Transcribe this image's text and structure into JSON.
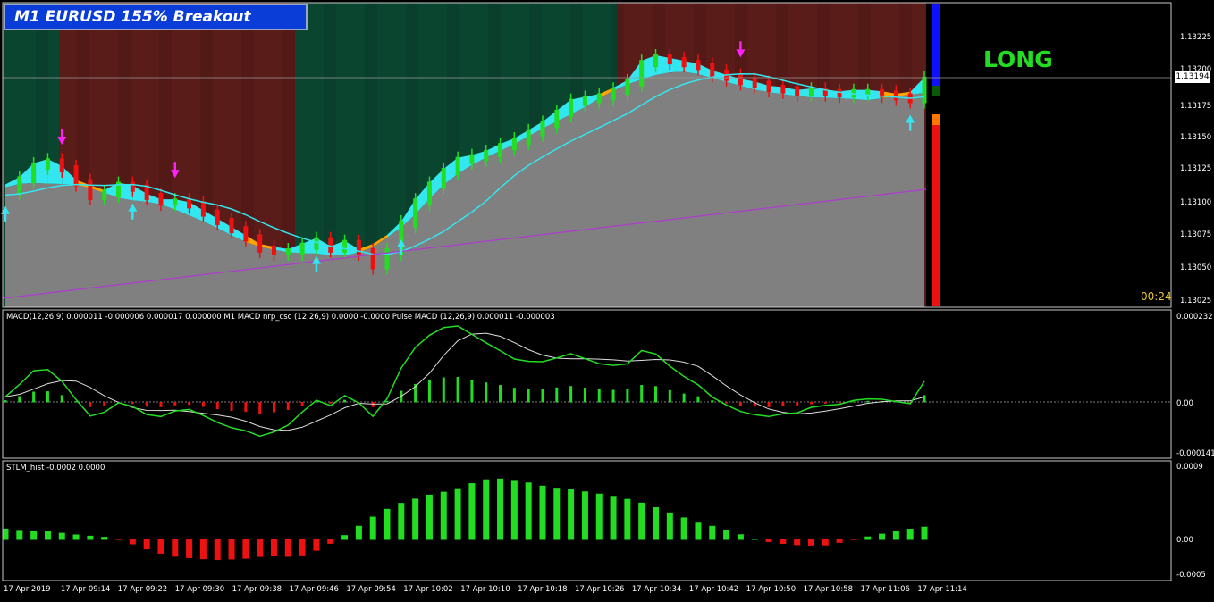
{
  "title": "M1 EURUSD  155% Breakout",
  "signal_text": "LONG",
  "timer": "00:24",
  "colors": {
    "bull": "#22dd22",
    "bear": "#ee1111",
    "cyan": "#33e6f0",
    "orange": "#ffa500",
    "magenta": "#ff22ff",
    "purple": "#b03ad0",
    "zone_green": "#0a4530",
    "zone_red": "#5a1c18",
    "fill_gray": "#808080",
    "signal_bar_blue": "#1010ff"
  },
  "main_chart": {
    "symbol": "EURUSD",
    "timeframe": "M1",
    "current_price": "1.13194",
    "price_ticks": [
      "1.13225",
      "1.13200",
      "1.13175",
      "1.13150",
      "1.13125",
      "1.13100",
      "1.13075",
      "1.13050",
      "1.13025"
    ],
    "ylim": [
      1.1302,
      1.1324
    ]
  },
  "macd_panel": {
    "label": "MACD(12,26,9) 0.000011 -0.000006 0.000017 0.000000  M1 MACD nrp_csc (12,26,9) 0.0000 -0.0000  Pulse MACD (12,26,9) 0.000011 -0.000003",
    "ticks": [
      "0.000232",
      "0.00",
      "-0.000141"
    ]
  },
  "stlm_panel": {
    "label": "STLM_hist -0.0002 0.0000",
    "ticks": [
      "0.0009",
      "0.00",
      "-0.0005"
    ]
  },
  "time_labels": [
    "17 Apr 2019",
    "17 Apr 09:14",
    "17 Apr 09:22",
    "17 Apr 09:30",
    "17 Apr 09:38",
    "17 Apr 09:46",
    "17 Apr 09:54",
    "17 Apr 10:02",
    "17 Apr 10:10",
    "17 Apr 10:18",
    "17 Apr 10:26",
    "17 Apr 10:34",
    "17 Apr 10:42",
    "17 Apr 10:50",
    "17 Apr 10:58",
    "17 Apr 11:06",
    "17 Apr 11:14"
  ],
  "chart_data": {
    "type": "line",
    "title": "M1 EURUSD  155% Breakout",
    "x": [
      "09:06",
      "09:08",
      "09:10",
      "09:12",
      "09:14",
      "09:16",
      "09:18",
      "09:20",
      "09:22",
      "09:24",
      "09:26",
      "09:28",
      "09:30",
      "09:32",
      "09:34",
      "09:36",
      "09:38",
      "09:40",
      "09:42",
      "09:44",
      "09:46",
      "09:48",
      "09:50",
      "09:52",
      "09:54",
      "09:56",
      "09:58",
      "10:00",
      "10:02",
      "10:04",
      "10:06",
      "10:08",
      "10:10",
      "10:12",
      "10:14",
      "10:16",
      "10:18",
      "10:20",
      "10:22",
      "10:24",
      "10:26",
      "10:28",
      "10:30",
      "10:32",
      "10:34",
      "10:36",
      "10:38",
      "10:40",
      "10:42",
      "10:44",
      "10:46",
      "10:48",
      "10:50",
      "10:52",
      "10:54",
      "10:56",
      "10:58",
      "11:00",
      "11:02",
      "11:04",
      "11:06",
      "11:08",
      "11:10",
      "11:12",
      "11:14",
      "11:16"
    ],
    "series": [
      {
        "values": [
          1.13104,
          1.13112,
          1.13122,
          1.13125,
          1.1312,
          1.1311,
          1.131,
          1.13102,
          1.13108,
          1.13106,
          1.131,
          1.13096,
          1.13096,
          1.13094,
          1.13088,
          1.13082,
          1.13076,
          1.1307,
          1.13062,
          1.1306,
          1.1306,
          1.13064,
          1.13068,
          1.13062,
          1.13066,
          1.1306,
          1.1305,
          1.1306,
          1.1308,
          1.13096,
          1.13108,
          1.13118,
          1.13126,
          1.13128,
          1.13131,
          1.13136,
          1.1314,
          1.13146,
          1.13152,
          1.1316,
          1.13168,
          1.1317,
          1.13172,
          1.13176,
          1.13182,
          1.13196,
          1.132,
          1.13198,
          1.13196,
          1.13194,
          1.13189,
          1.13186,
          1.13183,
          1.13181,
          1.13178,
          1.13177,
          1.13175,
          1.13176,
          1.13175,
          1.13174,
          1.13175,
          1.13175,
          1.13174,
          1.13172,
          1.1317,
          1.13184
        ]
      }
    ],
    "ylim": [
      1.1302,
      1.1324
    ],
    "grid": false
  }
}
